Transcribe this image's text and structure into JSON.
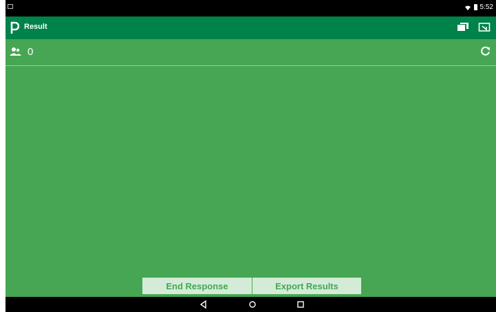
{
  "status_bar": {
    "time": "5:52",
    "icons": [
      "notification-icon",
      "wifi-icon",
      "battery-icon"
    ]
  },
  "app_bar": {
    "title": "Result",
    "icons": [
      "app-logo-icon",
      "chat-icon",
      "screen-cast-icon"
    ]
  },
  "results": {
    "participant_count": "0",
    "icons": [
      "participants-icon",
      "refresh-icon"
    ]
  },
  "actions": {
    "end_response": "End Response",
    "export_results": "Export Results"
  },
  "nav_bar": {
    "icons": [
      "back-icon",
      "home-icon",
      "recent-apps-icon"
    ]
  },
  "colors": {
    "app_bar": "#00824b",
    "background": "#46a653",
    "button_bg": "#d4ecd7",
    "button_text": "#45a653"
  }
}
